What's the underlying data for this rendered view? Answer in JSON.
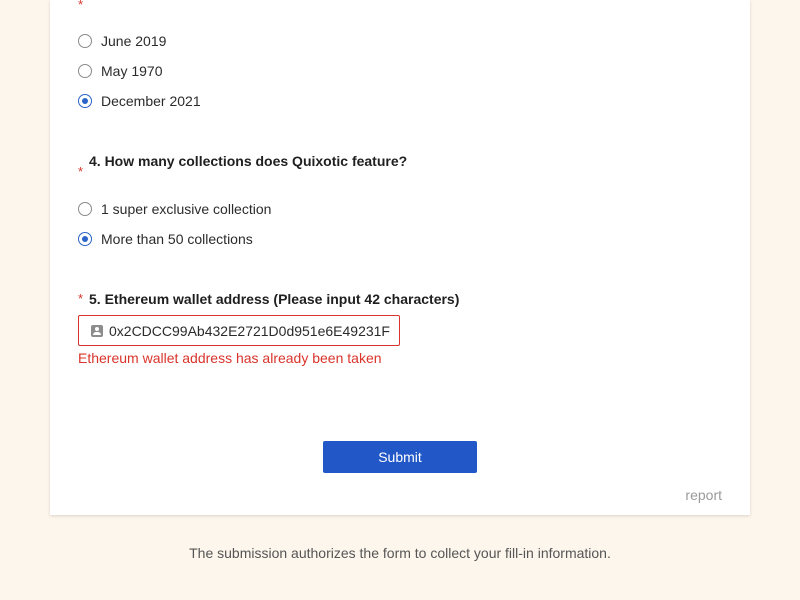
{
  "form": {
    "q3": {
      "required_mark": "*",
      "options": [
        {
          "label": "June 2019",
          "checked": false
        },
        {
          "label": "May 1970",
          "checked": false
        },
        {
          "label": "December 2021",
          "checked": true
        }
      ]
    },
    "q4": {
      "required_mark": "*",
      "title": "4. How many collections does Quixotic feature?",
      "options": [
        {
          "label": "1 super exclusive collection",
          "checked": false
        },
        {
          "label": "More than 50 collections",
          "checked": true
        }
      ]
    },
    "q5": {
      "required_mark": "*",
      "title": "5. Ethereum wallet address (Please input 42 characters)",
      "value": "0x2CDCC99Ab432E2721D0d951e6E49231F",
      "error": "Ethereum wallet address has already been taken",
      "icon": "user-card-icon"
    },
    "submit_label": "Submit",
    "report_label": "report"
  },
  "footer": {
    "text": "The submission authorizes the form to collect your fill-in information."
  },
  "colors": {
    "accent": "#2157c7",
    "error": "#d9342b",
    "background": "#fdf6ec"
  }
}
